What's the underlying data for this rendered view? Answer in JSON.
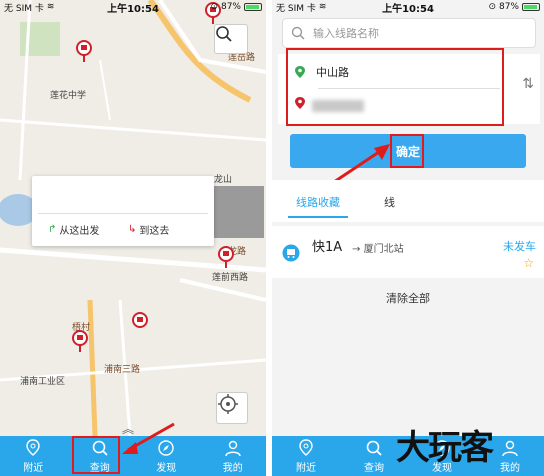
{
  "status_left": {
    "carrier": "无 SIM 卡",
    "time": "上午10:54",
    "battery": "87%"
  },
  "status_right": {
    "carrier": "无 SIM 卡",
    "time": "上午10:54",
    "battery": "87%"
  },
  "map": {
    "labels": {
      "school": "莲花中学",
      "longshan": "龙山",
      "lianqian_w": "莲前西路",
      "industrial": "浦南工业区",
      "road_a": "莲岳路",
      "road_b": "浦南三路",
      "road_c": "路",
      "road_d": "梧村",
      "road_e": "龙路"
    },
    "popup": {
      "from_label": "从这出发",
      "to_label": "到这去"
    }
  },
  "tabbar": {
    "items": [
      "附近",
      "查询",
      "发现",
      "我的"
    ]
  },
  "right": {
    "search_placeholder": "输入线路名称",
    "start_stop": "中山路",
    "end_stop": "",
    "confirm_label": "确定",
    "tabs": [
      "线路收藏",
      "线"
    ],
    "favorite": {
      "route": "快1A",
      "arrow": "→",
      "destination": "厦门北站",
      "status": "未发车"
    },
    "clear_all": "清除全部"
  },
  "watermark": "大玩客",
  "colors": {
    "accent": "#2aa7ea",
    "highlight": "#e01b1b",
    "star": "#f0a000"
  }
}
